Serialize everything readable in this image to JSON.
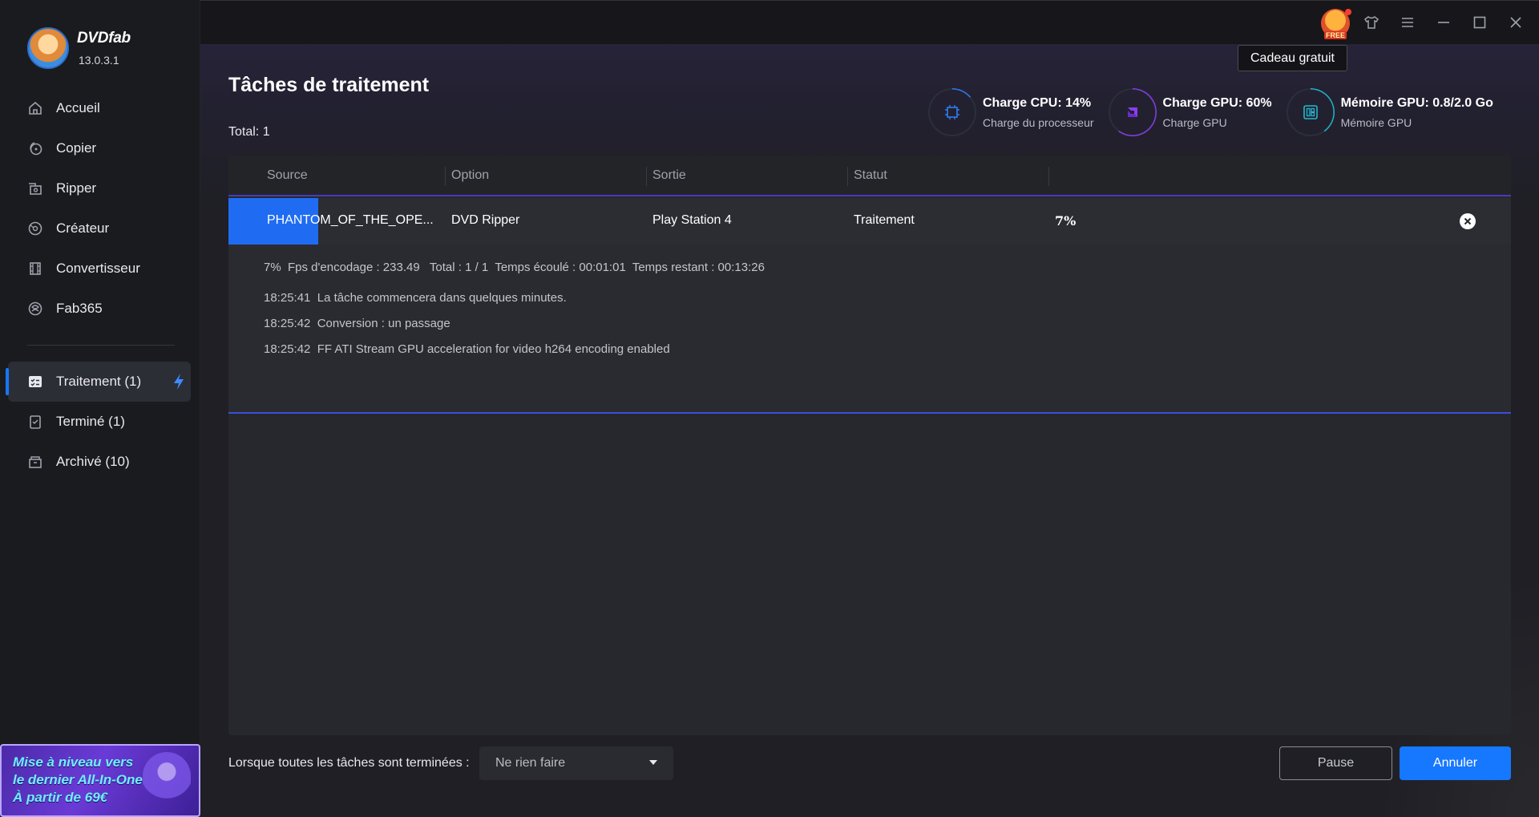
{
  "app": {
    "name": "DVDfab",
    "version": "13.0.3.1",
    "accent_color": "#1677ff"
  },
  "titlebar": {
    "gift_badge": "FREE",
    "tooltip": "Cadeau gratuit",
    "icons": [
      "gift-icon",
      "shirt-icon",
      "menu-icon",
      "minimize-icon",
      "maximize-icon",
      "close-icon"
    ]
  },
  "sidebar": {
    "nav": [
      {
        "label": "Accueil",
        "icon": "home-icon"
      },
      {
        "label": "Copier",
        "icon": "copy-icon"
      },
      {
        "label": "Ripper",
        "icon": "ripper-icon"
      },
      {
        "label": "Créateur",
        "icon": "creator-icon"
      },
      {
        "label": "Convertisseur",
        "icon": "converter-icon"
      },
      {
        "label": "Fab365",
        "icon": "fab365-icon"
      }
    ],
    "tasks": [
      {
        "label": "Traitement (1)",
        "icon": "tasks-icon",
        "active": true
      },
      {
        "label": "Terminé (1)",
        "icon": "finished-icon"
      },
      {
        "label": "Archivé (10)",
        "icon": "archive-icon"
      }
    ],
    "promo": {
      "line1": "Mise à niveau vers",
      "line2": "le dernier All-In-One",
      "line3": "À partir de 69€"
    }
  },
  "main": {
    "title": "Tâches de traitement",
    "total": "Total: 1",
    "monitors": [
      {
        "title": "Charge CPU: 14%",
        "subtitle": "Charge du processeur",
        "value": 0.14,
        "color": "#2f7cf6"
      },
      {
        "title": "Charge GPU: 60%",
        "subtitle": "Charge GPU",
        "value": 0.6,
        "color": "#8a3cf0"
      },
      {
        "title": "Mémoire GPU: 0.8/2.0 Go",
        "subtitle": "Mémoire GPU",
        "value": 0.4,
        "color": "#22b8cf"
      }
    ],
    "table": {
      "columns": [
        "Source",
        "Option",
        "Sortie",
        "Statut"
      ],
      "rows": [
        {
          "source": "PHANTOM_OF_THE_OPE...",
          "option": "DVD Ripper",
          "output": "Play Station 4",
          "status": "Traitement",
          "progress_label": "7%",
          "progress": 0.07
        }
      ]
    },
    "log": {
      "stats": "7%  Fps d'encodage : 233.49   Total : 1 / 1  Temps écoulé : 00:01:01  Temps restant : 00:13:26",
      "lines": [
        "18:25:41  La tâche commencera dans quelques minutes.",
        "18:25:42  Conversion : un passage",
        "18:25:42  FF ATI Stream GPU acceleration for video h264 encoding enabled"
      ]
    }
  },
  "footer": {
    "when_done_label": "Lorsque toutes les tâches sont terminées :",
    "when_done_value": "Ne rien faire",
    "pause_label": "Pause",
    "cancel_label": "Annuler"
  }
}
